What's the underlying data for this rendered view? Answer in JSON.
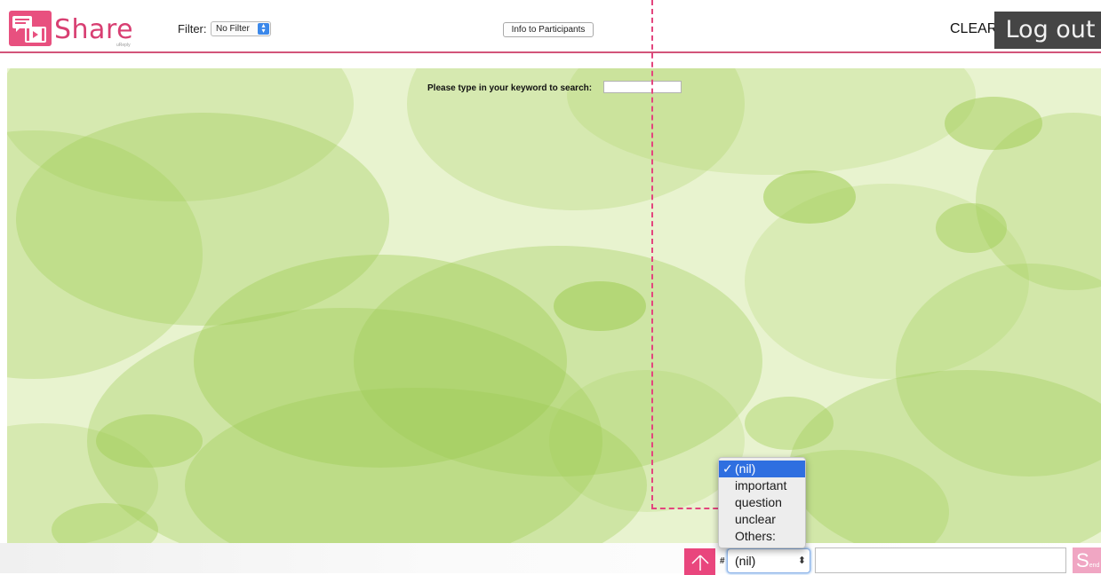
{
  "header": {
    "logo_text": "Share",
    "logo_sub": "uReply",
    "filter_label": "Filter:",
    "filter_value": "No Filter",
    "info_button": "Info to Participants",
    "clear_button": "CLEAR",
    "logout_button": "Log out"
  },
  "search": {
    "label": "Please type in your keyword to search:",
    "value": ""
  },
  "composer": {
    "hash_label": "#",
    "tag_value": "(nil)",
    "message_value": "",
    "send_label": "S",
    "send_label_rest": "end"
  },
  "tag_dropdown": {
    "items": [
      {
        "label": "(nil)",
        "selected": true
      },
      {
        "label": "important",
        "selected": false
      },
      {
        "label": "question",
        "selected": false
      },
      {
        "label": "unclear",
        "selected": false
      },
      {
        "label": "Others:",
        "selected": false
      }
    ],
    "check_mark": "✓"
  },
  "icons": {
    "up_arrow": "up-arrow-icon",
    "logo": "share-logo-icon",
    "select_arrows": "select-arrows-icon"
  },
  "colors": {
    "brand_pink": "#e8507f",
    "header_rule": "#d2547a",
    "logout_bg": "#454545",
    "bg_green": "#e8f3cf",
    "selection_blue": "#2f6fe0"
  }
}
